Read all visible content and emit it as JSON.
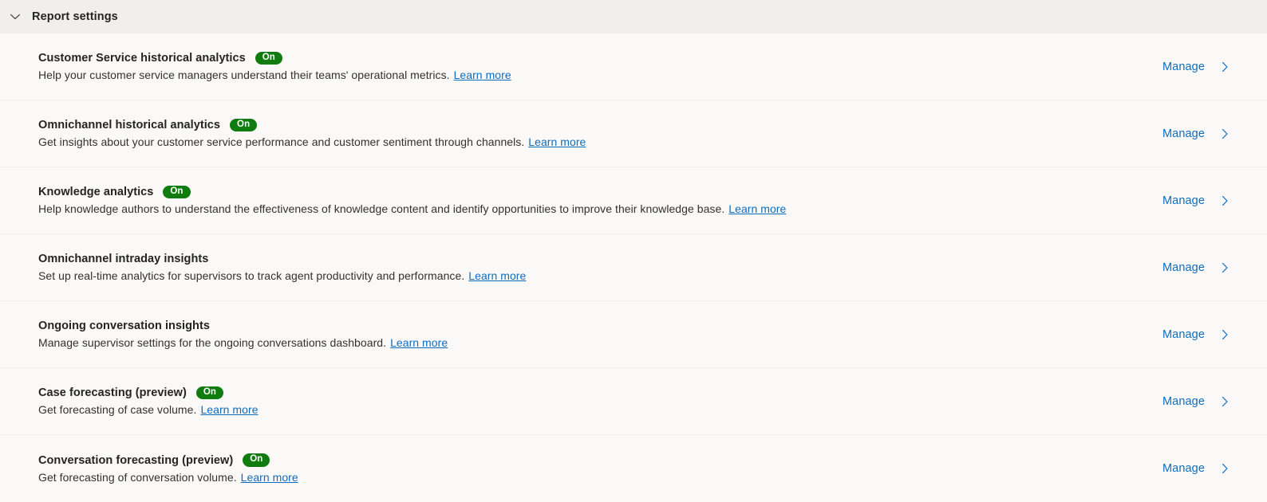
{
  "section": {
    "title": "Report settings",
    "expanded": true,
    "collapse_icon": "chevron-down-icon"
  },
  "colors": {
    "badge_green": "#107c10",
    "link_blue": "#0f6cbd",
    "header_bg": "#f0efee",
    "body_bg": "#faf9f8",
    "text": "#242424"
  },
  "common": {
    "manage_label": "Manage",
    "learn_more_label": "Learn more",
    "manage_icon": "chevron-right-icon"
  },
  "rows": [
    {
      "title": "Customer Service historical analytics",
      "badge": "On",
      "description": "Help your customer service managers understand their teams' operational metrics.",
      "learn_more": "Learn more",
      "action": "Manage"
    },
    {
      "title": "Omnichannel historical analytics",
      "badge": "On",
      "description": "Get insights about your customer service performance and customer sentiment through channels.",
      "learn_more": "Learn more",
      "action": "Manage"
    },
    {
      "title": "Knowledge analytics",
      "badge": "On",
      "description": "Help knowledge authors to understand the effectiveness of knowledge content and identify opportunities to improve their knowledge base.",
      "learn_more": "Learn more",
      "action": "Manage"
    },
    {
      "title": "Omnichannel intraday insights",
      "badge": "",
      "description": "Set up real-time analytics for supervisors to track agent productivity and performance.",
      "learn_more": "Learn more",
      "action": "Manage"
    },
    {
      "title": "Ongoing conversation insights",
      "badge": "",
      "description": "Manage supervisor settings for the ongoing conversations dashboard.",
      "learn_more": "Learn more",
      "action": "Manage"
    },
    {
      "title": "Case forecasting (preview)",
      "badge": "On",
      "description": "Get forecasting of case volume.",
      "learn_more": "Learn more",
      "action": "Manage"
    },
    {
      "title": "Conversation forecasting (preview)",
      "badge": "On",
      "description": "Get forecasting of conversation volume.",
      "learn_more": "Learn more",
      "action": "Manage"
    }
  ]
}
